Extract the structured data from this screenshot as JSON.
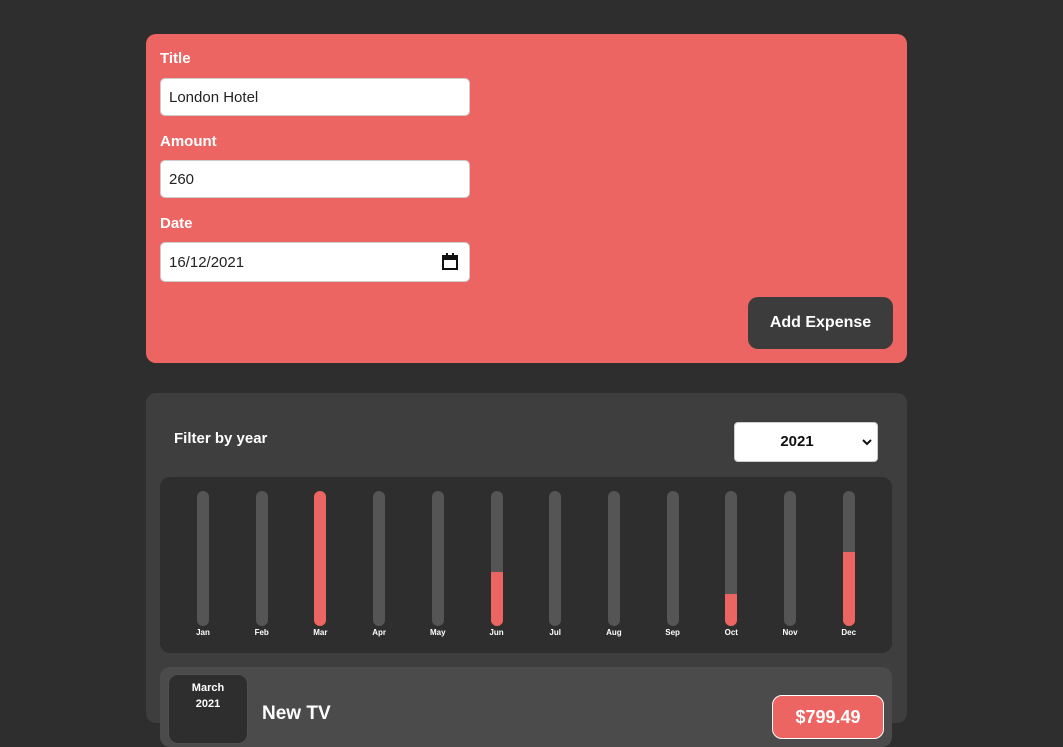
{
  "expense_form": {
    "title_label": "Title",
    "title_value": "London Hotel",
    "amount_label": "Amount",
    "amount_value": "260",
    "date_label": "Date",
    "date_value": "16/12/2021",
    "submit_label": "Add Expense"
  },
  "filter": {
    "label": "Filter by year",
    "selected_year": "2021"
  },
  "chart_data": {
    "type": "bar",
    "categories": [
      "Jan",
      "Feb",
      "Mar",
      "Apr",
      "May",
      "Jun",
      "Jul",
      "Aug",
      "Sep",
      "Oct",
      "Nov",
      "Dec"
    ],
    "values": [
      0,
      0,
      100,
      0,
      0,
      40,
      0,
      0,
      0,
      24,
      0,
      55
    ],
    "ylim": [
      0,
      100
    ],
    "unit": "percent of maximum month"
  },
  "expenses": [
    {
      "month": "March",
      "year": "2021",
      "title": "New TV",
      "amount": "$799.49"
    }
  ],
  "colors": {
    "accent": "#ec6562",
    "background": "#2e2e2e",
    "card": "#3e3e3e",
    "button": "#3c3c3c"
  }
}
